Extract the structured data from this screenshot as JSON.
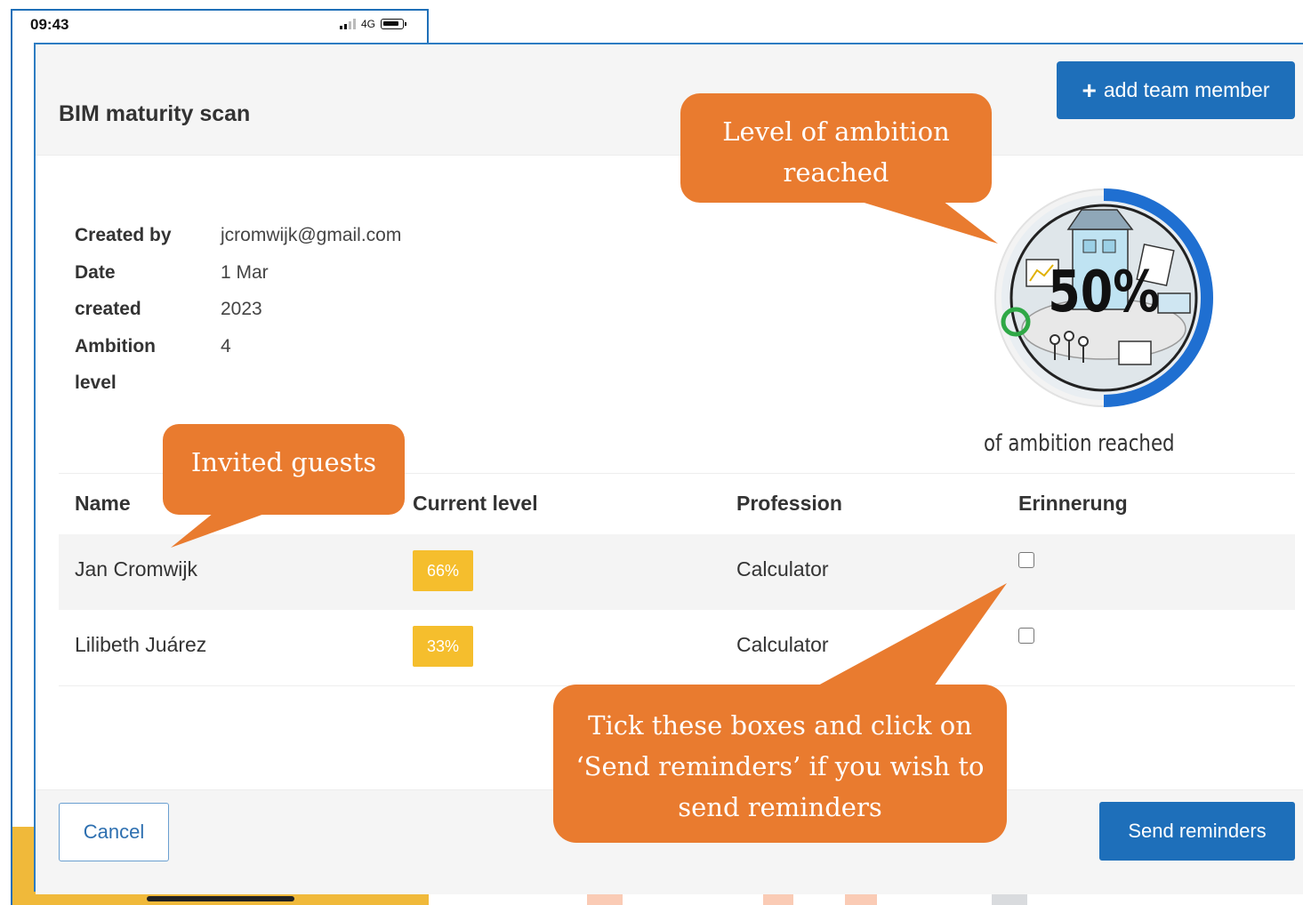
{
  "phone": {
    "time": "09:43",
    "network": "4G"
  },
  "modal": {
    "title": "BIM maturity scan",
    "add_button_label": "add team member"
  },
  "info": {
    "labels": [
      "Created by",
      "Date",
      "created",
      "Ambition",
      "level"
    ],
    "values": [
      "jcromwijk@gmail.com",
      "1 Mar",
      "2023",
      "4"
    ]
  },
  "badge": {
    "percent": "50%",
    "caption": "of ambition reached",
    "progress_fraction": 0.5,
    "accent_color": "#1f6fd1"
  },
  "table": {
    "headers": [
      "Name",
      "Current level",
      "Profession",
      "Erinnerung"
    ],
    "rows": [
      {
        "name": "Jan Cromwijk",
        "level": "66%",
        "profession": "Calculator",
        "reminder_checked": false
      },
      {
        "name": "Lilibeth Juárez",
        "level": "33%",
        "profession": "Calculator",
        "reminder_checked": false
      }
    ]
  },
  "footer": {
    "cancel_label": "Cancel",
    "send_label": "Send reminders"
  },
  "callouts": {
    "ambition_line1": "Level of ambition",
    "ambition_line2": "reached",
    "guests": "Invited guests",
    "reminders_line1": "Tick these boxes and click on",
    "reminders_line2": "‘Send reminders’ if you wish to",
    "reminders_line3": "send reminders",
    "color": "#e97b2f"
  },
  "colors": {
    "primary_button": "#1e6fba",
    "badge_level": "#f5be2d"
  }
}
